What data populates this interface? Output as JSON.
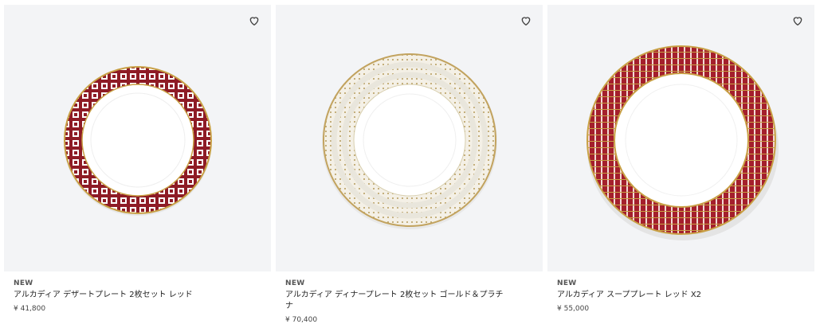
{
  "products": [
    {
      "badge": "NEW",
      "name": "アルカディア デザートプレート 2枚セット レッド",
      "price": "¥ 41,800",
      "favorite_icon": "heart-icon",
      "colors": {
        "rim": "#8e1b25",
        "accent": "#c8a045",
        "center": "#ffffff"
      }
    },
    {
      "badge": "NEW",
      "name": "アルカディア ディナープレート 2枚セット ゴールド＆プラチナ",
      "price": "¥ 70,400",
      "favorite_icon": "heart-icon",
      "colors": {
        "rim": "#f2efe6",
        "accent": "#b59a5a",
        "center": "#ffffff"
      }
    },
    {
      "badge": "NEW",
      "name": "アルカディア スーププレート レッド X2",
      "price": "¥ 55,000",
      "favorite_icon": "heart-icon",
      "colors": {
        "rim": "#a41f2c",
        "accent": "#c8a045",
        "center": "#ffffff"
      }
    }
  ]
}
